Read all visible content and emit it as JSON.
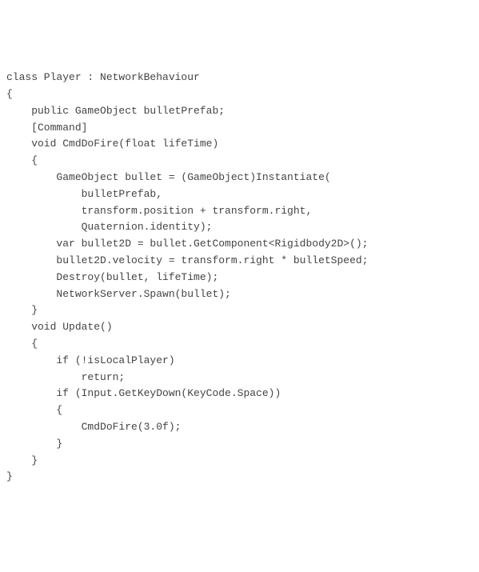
{
  "code": {
    "lines": [
      "class Player : NetworkBehaviour",
      "{",
      "",
      "    public GameObject bulletPrefab;",
      "",
      "    [Command]",
      "    void CmdDoFire(float lifeTime)",
      "    {",
      "        GameObject bullet = (GameObject)Instantiate(",
      "            bulletPrefab, ",
      "            transform.position + transform.right,",
      "            Quaternion.identity);",
      "",
      "        var bullet2D = bullet.GetComponent<Rigidbody2D>();",
      "        bullet2D.velocity = transform.right * bulletSpeed;",
      "        Destroy(bullet, lifeTime);",
      "",
      "        NetworkServer.Spawn(bullet);",
      "    }",
      "",
      "    void Update()",
      "    {",
      "        if (!isLocalPlayer)",
      "            return;",
      "",
      "        if (Input.GetKeyDown(KeyCode.Space))",
      "        {",
      "            CmdDoFire(3.0f);",
      "        }",
      "",
      "    }",
      "}"
    ]
  }
}
